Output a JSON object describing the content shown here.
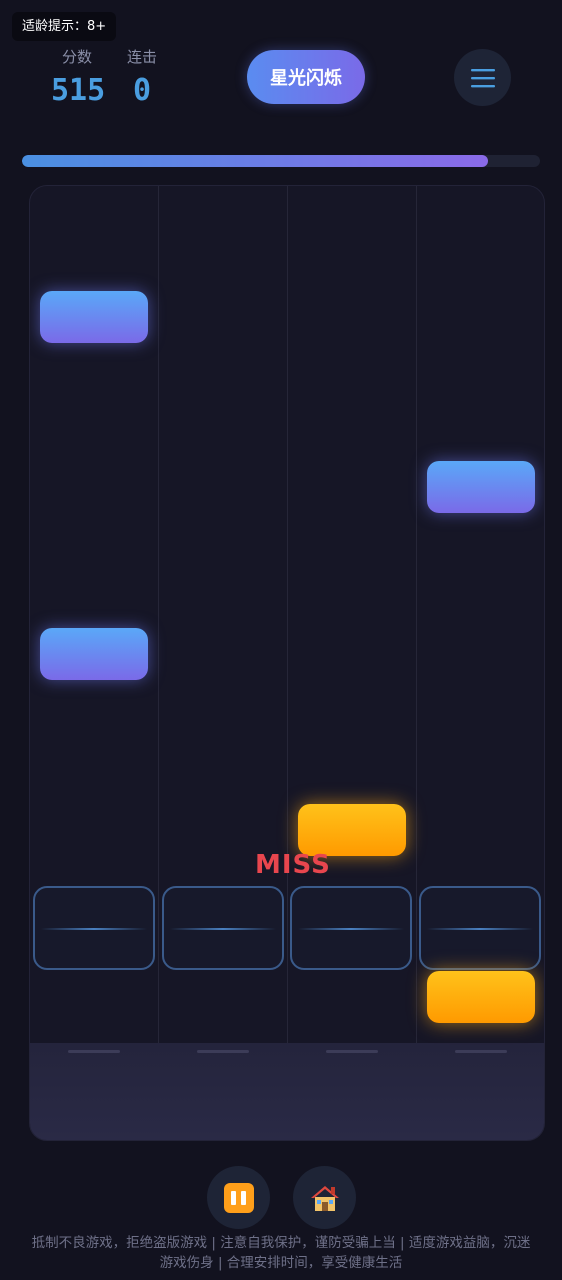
{
  "age_badge": "适龄提示：8+",
  "stats": {
    "score_label": "分数",
    "score_value": "515",
    "combo_label": "连击",
    "combo_value": "0"
  },
  "song_title": "星光闪烁",
  "menu_icon": "hamburger-menu-icon",
  "progress": 0.9,
  "judgement": "MISS",
  "lanes": 4,
  "notes": [
    {
      "lane": 1,
      "color": "blue"
    },
    {
      "lane": 4,
      "color": "blue"
    },
    {
      "lane": 1,
      "color": "blue"
    },
    {
      "lane": 3,
      "color": "gold"
    },
    {
      "lane": 4,
      "color": "gold"
    }
  ],
  "controls": {
    "pause_icon": "pause-icon",
    "home_icon": "home-icon"
  },
  "footer": {
    "line1": "抵制不良游戏，拒绝盗版游戏 | 注意自我保护，谨防受骗上当 | 适度游戏益脑，沉迷",
    "line2": "游戏伤身 | 合理安排时间，享受健康生活"
  },
  "colors": {
    "accent_blue": "#4a9ee0",
    "note_blue": "#6a8cf0",
    "note_gold": "#ffb20a",
    "miss_red": "#e8464e",
    "background": "#12121f"
  }
}
